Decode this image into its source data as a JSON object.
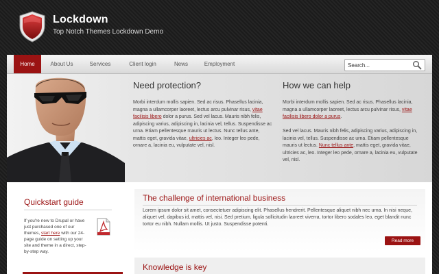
{
  "site": {
    "title": "Lockdown",
    "slogan": "Top Notch Themes Lockdown Demo"
  },
  "nav": {
    "items": [
      {
        "label": "Home",
        "active": true
      },
      {
        "label": "About Us",
        "active": false
      },
      {
        "label": "Services",
        "active": false
      },
      {
        "label": "Client login",
        "active": false
      },
      {
        "label": "News",
        "active": false
      },
      {
        "label": "Employment",
        "active": false
      }
    ]
  },
  "search": {
    "placeholder": "Search...",
    "icon": "magnifier-icon"
  },
  "hero": {
    "col1": {
      "title": "Need protection?",
      "p1_a": "Morbi interdum mollis sapien. Sed ac risus. Phasellus lacinia, magna a ullamcorper laoreet, lectus arcu pulvinar risus, ",
      "p1_link": "vitae facilisis libero",
      "p1_b": " dolor a purus. Sed vel lacus. Mauris nibh felis, adipiscing varius, adipiscing in, lacinia vel, tellus. Suspendisse ac urna. Etiam pellentesque mauris ut lectus. Nunc tellus ante, mattis eget, gravida vitae, ",
      "p1_link2": "ultricies ac",
      "p1_c": ", leo. Integer leo pede, ornare a, lacinia eu, vulputate vel, nisl."
    },
    "col2": {
      "title": "How we can help",
      "p1_a": "Morbi interdum mollis sapien. Sed ac risus. Phasellus lacinia, magna a ullamcorper laoreet, lectus arcu pulvinar risus, ",
      "p1_link": "vitae facilisis libero dolor a purus",
      "p1_b": ".",
      "p2_a": "Sed vel lacus. Mauris nibh felis, adipiscing varius, adipiscing in, lacinia vel, tellus. Suspendisse ac urna. Etiam pellentesque mauris ut lectus. ",
      "p2_link": "Nunc tellus ante",
      "p2_b": ", mattis eget, gravida vitae, ultricies ac, leo. Integer leo pede, ornare a, lacinia eu, vulputate vel, nisl."
    }
  },
  "sidebar": {
    "title": "Quickstart guide",
    "text_a": "If you're new to Drupal or have just purchased one of our themes, ",
    "text_link": "start here",
    "text_b": " with our 24-page guide on setting up your site and theme in a direct, step-by-step way."
  },
  "main": {
    "title": "The challenge of international business",
    "text": "Lorem ipsum dolor sit amet, consectetuer adipiscing elit. Phasellus hendrerit. Pellentesque aliquet nibh nec urna. In nisi neque, aliquet vel, dapibus id, mattis vel, nisi. Sed pretium, ligula sollicitudin laoreet viverra, tortor libero sodales leo, eget blandit nunc tortor eu nibh. Nullam mollis. Ut justo. Suspendisse potenti.",
    "read_more": "Read more"
  },
  "card2": {
    "title": "Knowledge is key"
  },
  "colors": {
    "accent": "#9b1313",
    "header_bg": "#1e1e1e"
  }
}
